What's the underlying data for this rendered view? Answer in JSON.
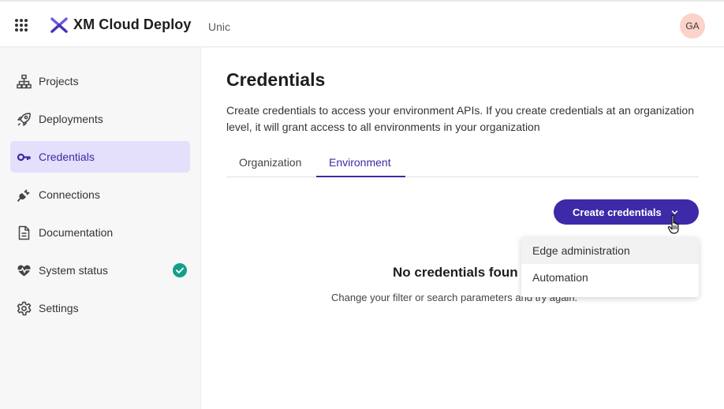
{
  "header": {
    "app_title": "XM Cloud Deploy",
    "org_name": "Unic",
    "avatar_initials": "GA",
    "brand_color": "#3d2aa8",
    "avatar_color": "#fbd3c8"
  },
  "sidebar": {
    "items": [
      {
        "label": "Projects",
        "icon": "sitemap-icon"
      },
      {
        "label": "Deployments",
        "icon": "rocket-icon"
      },
      {
        "label": "Credentials",
        "icon": "key-icon",
        "active": true
      },
      {
        "label": "Connections",
        "icon": "plug-icon"
      },
      {
        "label": "Documentation",
        "icon": "document-icon"
      },
      {
        "label": "System status",
        "icon": "heartbeat-icon",
        "status": "ok"
      },
      {
        "label": "Settings",
        "icon": "gear-icon"
      }
    ],
    "active_color": "#e4dffb",
    "status_color": "#12a08a"
  },
  "main": {
    "title": "Credentials",
    "description": "Create credentials to access your environment APIs. If you create credentials at an organization level, it will grant access to all environments in your organization",
    "tabs": [
      {
        "label": "Organization",
        "active": false
      },
      {
        "label": "Environment",
        "active": true
      }
    ],
    "create_button_label": "Create credentials",
    "empty_title": "No credentials foun",
    "empty_subtitle": "Change your filter or search parameters and try again."
  },
  "dropdown": {
    "items": [
      {
        "label": "Edge administration",
        "hovered": true
      },
      {
        "label": "Automation",
        "hovered": false
      }
    ]
  }
}
